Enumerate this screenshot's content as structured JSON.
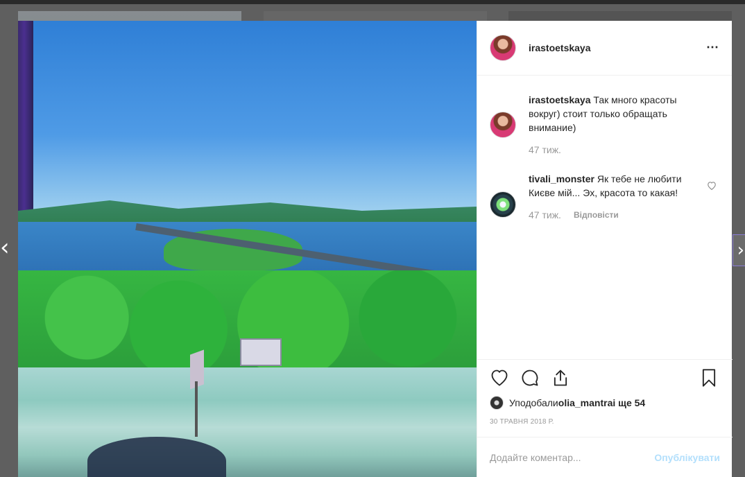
{
  "post": {
    "username": "irastoetskaya",
    "more_icon": "⋯"
  },
  "comments": [
    {
      "username": "irastoetskaya",
      "text": " Так много красоты вокруг) стоит только обращать внимание)",
      "time": "47 тиж.",
      "reply": ""
    },
    {
      "username": "tivali_monster",
      "text": " Як тебе не любити Києве мій... Эх, красота то какая!",
      "time": "47 тиж.",
      "reply": "Відповісти"
    }
  ],
  "likes": {
    "prefix": "Уподобали ",
    "user": "olia_mantra",
    "suffix": " і ще 54"
  },
  "date": "30 ТРАВНЯ 2018 Р.",
  "add_comment": {
    "placeholder": "Додайте коментар...",
    "post_label": "Опублікувати"
  },
  "nav": {
    "prev": "‹",
    "next": "›"
  },
  "colors": {
    "link_blue": "#b2dffc",
    "muted": "#999999",
    "text": "#262626"
  }
}
